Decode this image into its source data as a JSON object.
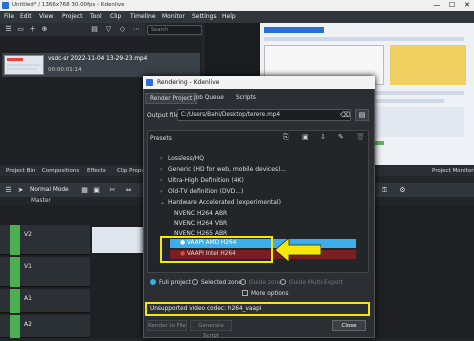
{
  "window": {
    "title": "Untitled* / 1366x768 30.00fps - Kdenlive",
    "min": "—",
    "max": "☐",
    "close": "✕"
  },
  "menu": [
    "File",
    "Edit",
    "View",
    "Project",
    "Tool",
    "Clip",
    "Timeline",
    "Monitor",
    "Settings",
    "Help"
  ],
  "bin": {
    "search_placeholder": "Search",
    "clip_name": "vsdc-sr 2022-11-04 13-29-23.mp4",
    "clip_duration": "00:00:01:14"
  },
  "bottom_tabs": [
    "Project Bin",
    "Compositions",
    "Effects",
    "Clip Proper"
  ],
  "project_monitor_tab": "Project Monitor",
  "timeline": {
    "mode": "Normal Mode",
    "master": "Master",
    "tracks": [
      "V2",
      "V1",
      "A1",
      "A2"
    ]
  },
  "dialog": {
    "title": "Rendering - Kdenlive",
    "tabs": [
      "Render Project",
      "Job Queue",
      "Scripts"
    ],
    "output_label": "Output file",
    "output_value": "C:/Users/Bahi/Desktop/terere.mp4",
    "presets_label": "Presets",
    "tree": [
      {
        "arrow": "›",
        "label": "Lossless/HQ"
      },
      {
        "arrow": "›",
        "label": "Generic (HD for web, mobile devices)..."
      },
      {
        "arrow": "›",
        "label": "Ultra-High Definition (4K)"
      },
      {
        "arrow": "›",
        "label": "Old-TV definition (DVD...)"
      },
      {
        "arrow": "⌄",
        "label": "Hardware Accelerated (experimental)"
      }
    ],
    "sub": [
      "NVENC H264 ABR",
      "NVENC H264 VBR",
      "NVENC H265 ABR"
    ],
    "vaapi_amd": "VAAPI AMD H264",
    "vaapi_intel": "VAAPI Intel H264",
    "radios": [
      "Full project",
      "Selected zone",
      "Guide zone",
      "Guide Multi-Export"
    ],
    "more_options": "More options",
    "warning": "Unsupported video codec: h264_vaapi",
    "btn_render": "Render to File",
    "btn_script": "Generate Script",
    "btn_close": "Close"
  },
  "colors": {
    "accent": "#3daee9",
    "highlight": "#f6e60a",
    "error_row": "#7a1e22"
  }
}
